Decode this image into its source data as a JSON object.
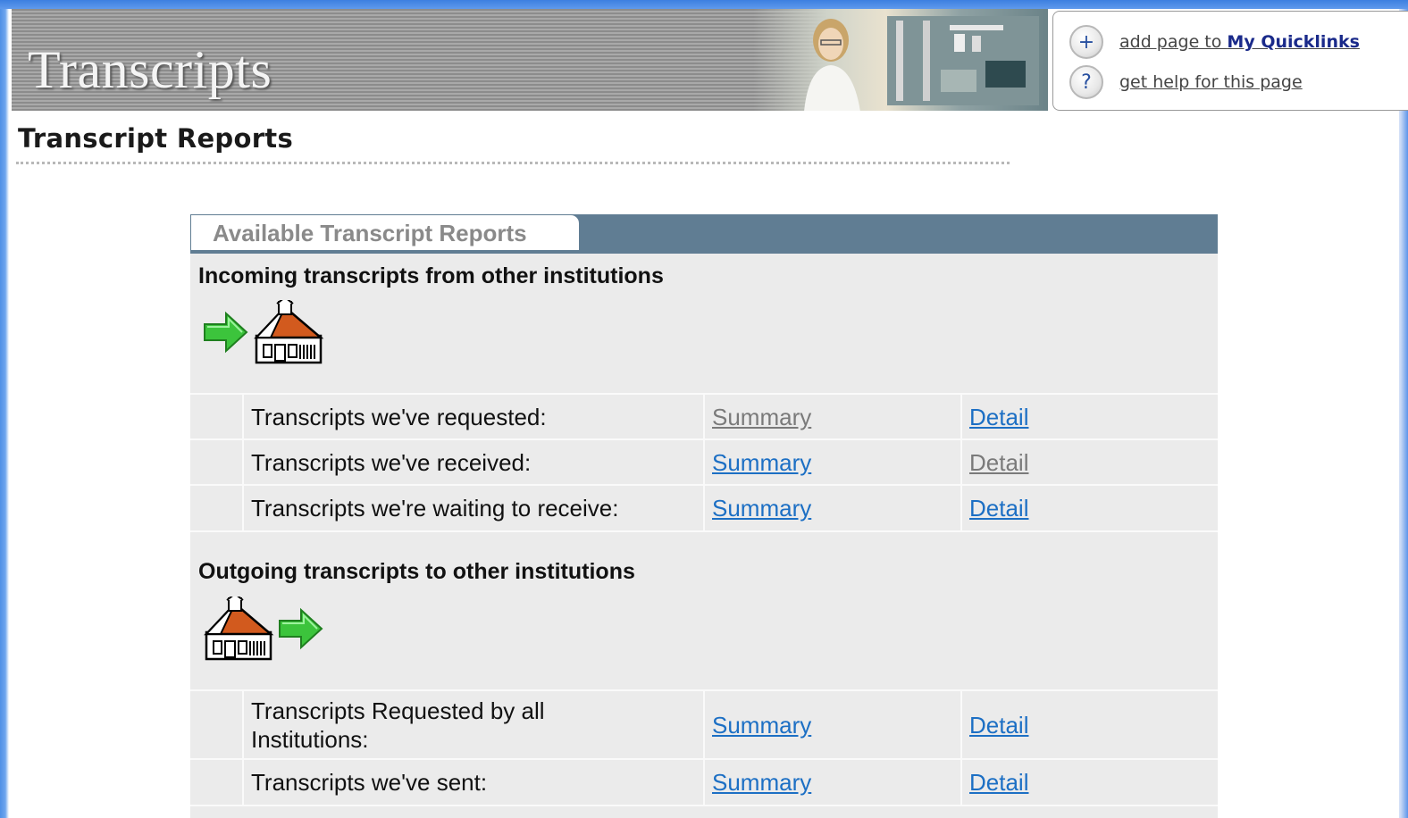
{
  "banner": {
    "title": "Transcripts"
  },
  "quicklinks": {
    "add_prefix": "add page to ",
    "add_target": "My Quicklinks",
    "help": "get help for this page",
    "add_icon": "+",
    "help_icon": "?"
  },
  "page_title": "Transcript Reports",
  "reports": {
    "tab_label": "Available Transcript Reports",
    "incoming": {
      "heading": "Incoming transcripts from other institutions",
      "icons": [
        "green-arrow-icon",
        "schoolhouse-icon"
      ],
      "rows": [
        {
          "label": "Transcripts we've requested:",
          "summary": "Summary",
          "detail": "Detail"
        },
        {
          "label": "Transcripts we've received:",
          "summary": "Summary",
          "detail": "Detail"
        },
        {
          "label": "Transcripts we're waiting to receive:",
          "summary": "Summary",
          "detail": "Detail"
        }
      ]
    },
    "outgoing": {
      "heading": "Outgoing transcripts to other institutions",
      "icons": [
        "schoolhouse-icon",
        "green-arrow-icon"
      ],
      "rows": [
        {
          "label": "Transcripts Requested by all Institutions:",
          "summary": "Summary",
          "detail": "Detail"
        },
        {
          "label": "Transcripts we've sent:",
          "summary": "Summary",
          "detail": "Detail"
        }
      ]
    }
  },
  "colors": {
    "header_bar": "#607d93",
    "link": "#1c6fc4",
    "visited_link": "#7a7a7a",
    "arrow_green": "#3cc43c",
    "roof_orange": "#d25a1e"
  }
}
